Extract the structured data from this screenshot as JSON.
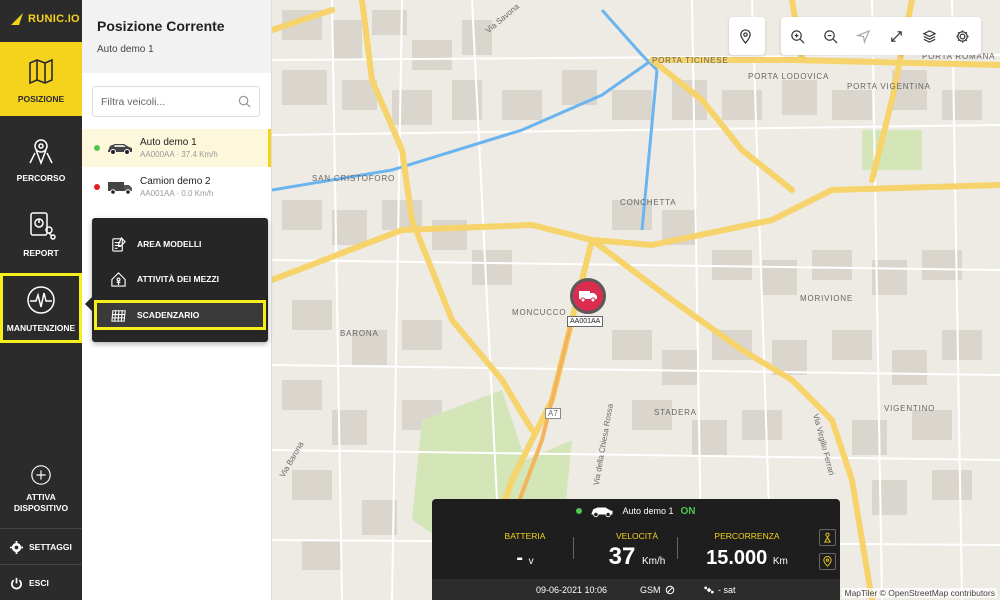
{
  "app": {
    "logo_text": "RUNIC.IO"
  },
  "sidebar": {
    "items": [
      {
        "label": "POSIZIONE"
      },
      {
        "label": "PERCORSO"
      },
      {
        "label": "REPORT"
      },
      {
        "label": "MANUTENZIONE"
      }
    ],
    "activate_device": "ATTIVA DISPOSITIVO",
    "settings": "SETTAGGI",
    "logout": "ESCI"
  },
  "panel": {
    "title": "Posizione Corrente",
    "subtitle": "Auto demo 1",
    "search_placeholder": "Filtra veicoli...",
    "vehicles": [
      {
        "name": "Auto demo 1",
        "meta": "AA000AA · 37.4 Km/h",
        "status_color": "#4fc64f"
      },
      {
        "name": "Camion demo 2",
        "meta": "AA001AA · 0.0 Km/h",
        "status_color": "#e02020"
      }
    ]
  },
  "menu": {
    "items": [
      {
        "label": "AREA MODELLI"
      },
      {
        "label": "ATTIVITÀ DEI MEZZI"
      },
      {
        "label": "SCADENZARIO"
      }
    ]
  },
  "map": {
    "labels": {
      "via_savona": "Via Savona",
      "porta_ticinese": "PORTA TICINESE",
      "porta_lodovica": "PORTA LODOVICA",
      "porta_romana": "PORTA ROMANA",
      "porta_vigentina": "PORTA VIGENTINA",
      "san_cristoforo": "SAN CRISTOFORO",
      "conchetta": "CONCHETTA",
      "moncucco": "MONCUCCO",
      "barona": "BARONA",
      "morivione": "MORIVIONE",
      "stadera": "STADERA",
      "vigentino": "VIGENTINO",
      "via_barona": "Via Barona",
      "via_chiesa_rossa": "Via della Chiesa Rossa",
      "via_virgilio_ferrari": "Via Virgilio Ferrari",
      "a7": "A7"
    },
    "marker_plate": "AA001AA",
    "attribution": "MapTiler © OpenStreetMap contributors",
    "colors": {
      "major_road": "#f6d36b",
      "water": "#6ab4f0",
      "block": "#d9d4cb",
      "park": "#cfe3b0"
    }
  },
  "info": {
    "vehicle": "Auto demo 1",
    "status": "ON",
    "battery_label": "BATTERIA",
    "battery_value": "-",
    "battery_unit": "v",
    "speed_label": "VELOCITÀ",
    "speed_value": "37",
    "speed_unit": "Km/h",
    "distance_label": "PERCORRENZA",
    "distance_value": "15.000",
    "distance_unit": "Km",
    "datetime": "09-06-2021 10:06",
    "gsm": "GSM",
    "sat": "- sat"
  }
}
